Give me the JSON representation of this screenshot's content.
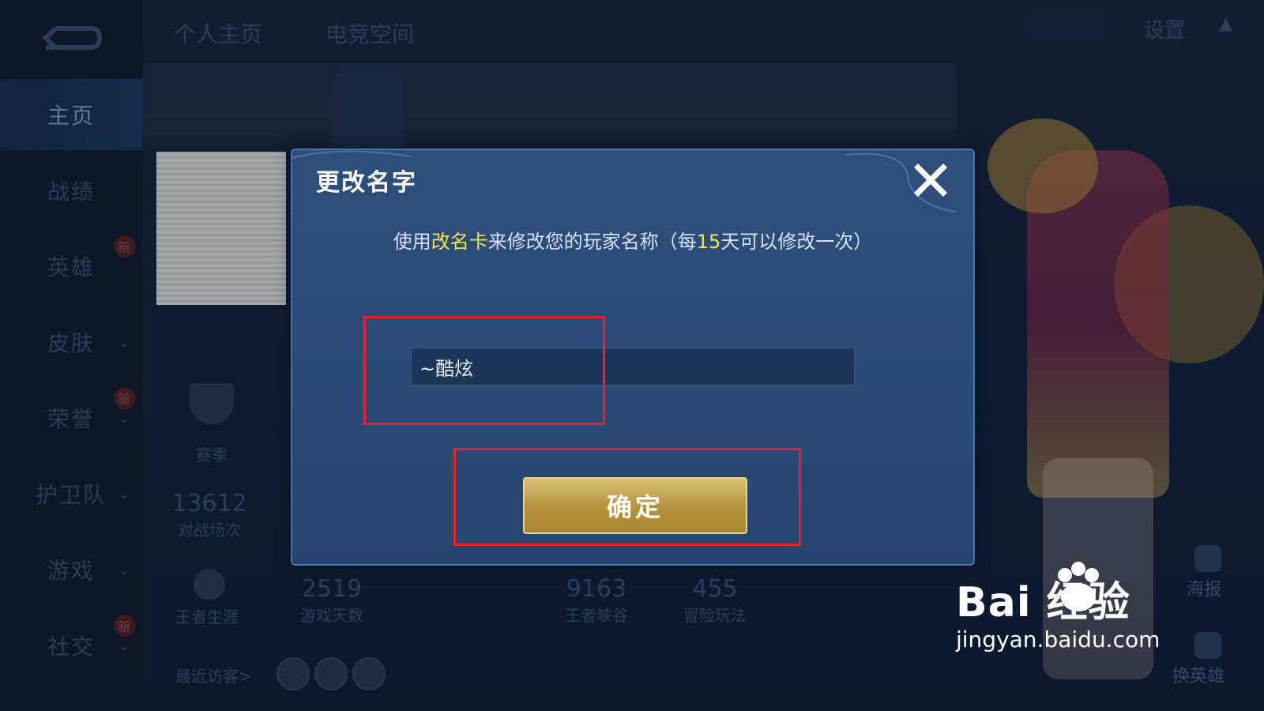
{
  "nav": {
    "items": [
      {
        "label": "主页",
        "active": true
      },
      {
        "label": "战绩"
      },
      {
        "label": "英雄",
        "badge": "新"
      },
      {
        "label": "皮肤",
        "chevron": "⌄"
      },
      {
        "label": "荣誉",
        "badge": "新",
        "chevron": "⌄"
      },
      {
        "label": "护卫队",
        "chevron": "⌄"
      },
      {
        "label": "游戏",
        "chevron": "⌄"
      },
      {
        "label": "社交",
        "badge": "新",
        "chevron": "⌄"
      }
    ]
  },
  "topbar": {
    "tabs": [
      "个人主页",
      "电竞空间"
    ],
    "settings_label": "设置"
  },
  "profile": {
    "season_label": "赛季",
    "matches": {
      "value": "13612",
      "label": "对战场次"
    },
    "career_label": "王者生涯",
    "days": {
      "value": "2519",
      "label": "游戏天数"
    },
    "valley": {
      "value": "9163",
      "label": "王者峡谷"
    },
    "adventure": {
      "value": "455",
      "label": "冒险玩法"
    },
    "visitors_label": "最近访客>"
  },
  "side": {
    "poster_label": "海报",
    "hero_label": "换英雄"
  },
  "dialog": {
    "title": "更改名字",
    "hint_prefix": "使用",
    "hint_highlight1": "改名卡",
    "hint_middle": "来修改您的玩家名称（每",
    "hint_highlight2": "15",
    "hint_suffix": "天可以修改一次）",
    "input_value": "~酷炫",
    "confirm_label": "确定"
  },
  "watermark": {
    "brand": "Bai  经验",
    "url": "jingyan.baidu.com"
  },
  "colors": {
    "highlight": "#f1e64b",
    "annotation": "#e5232f",
    "button_gold": "#b7963f"
  }
}
